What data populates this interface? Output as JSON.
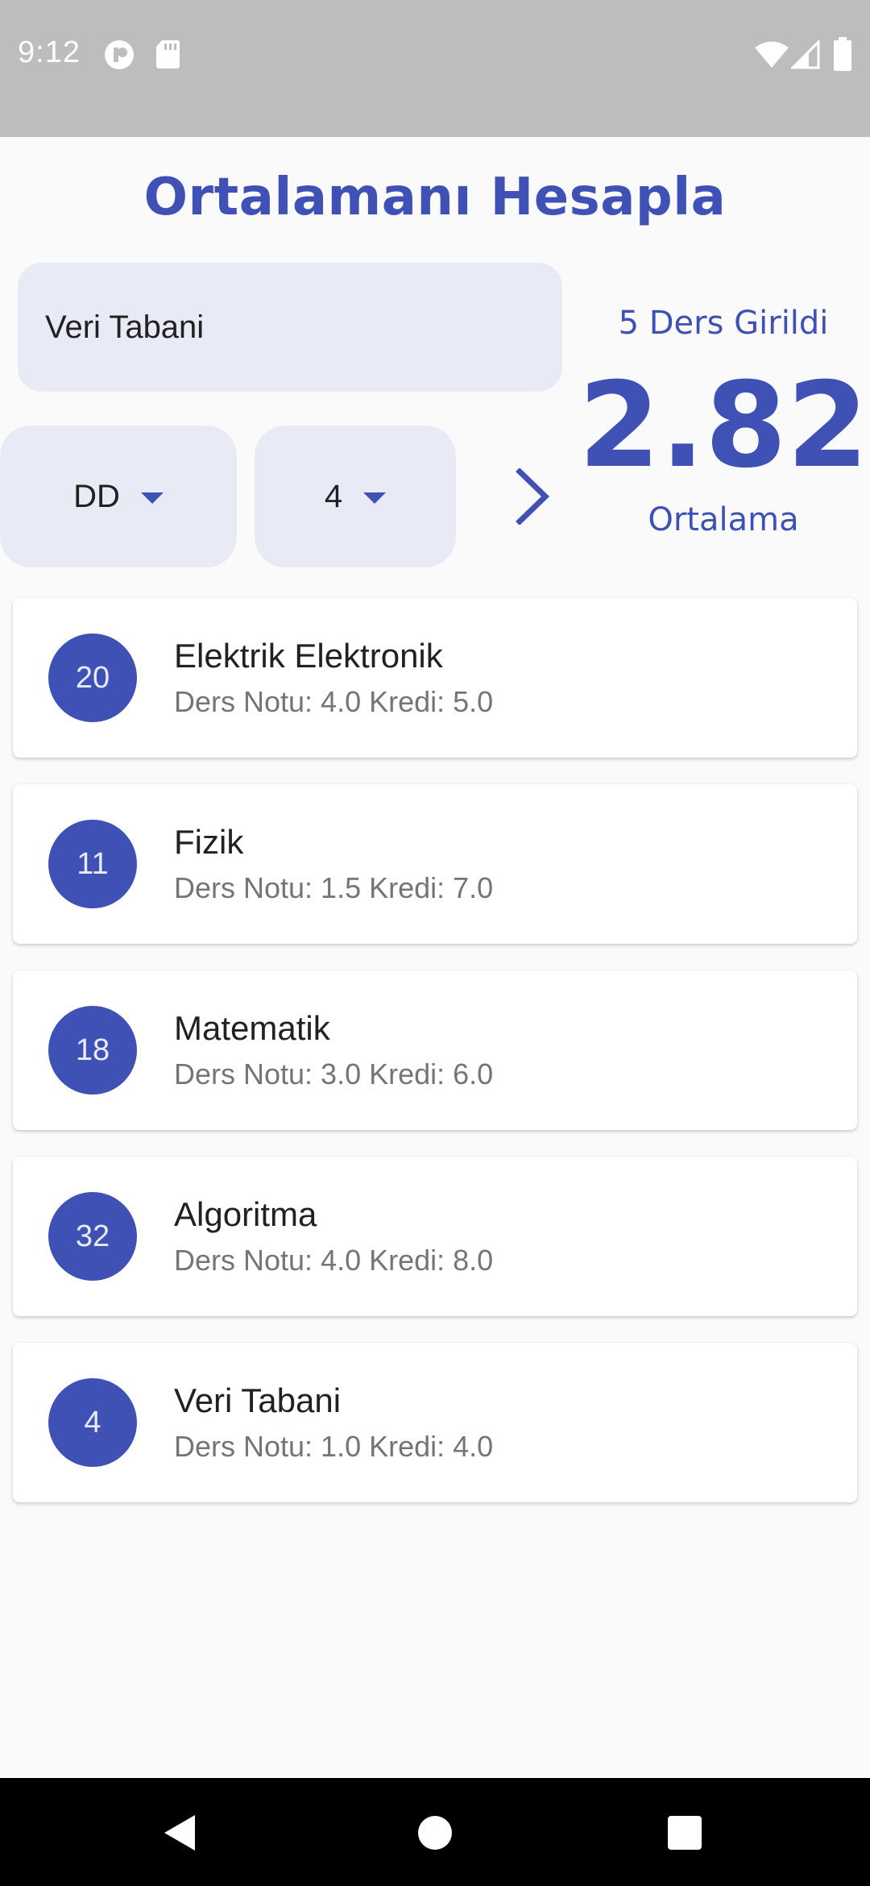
{
  "status_bar": {
    "time": "9:12",
    "icons": [
      "privacy-dot-icon",
      "sd-card-icon",
      "wifi-icon",
      "signal-icon",
      "battery-icon"
    ]
  },
  "app": {
    "title": "Ortalamanı Hesapla",
    "accent_color": "#3f51b5",
    "field_color": "#e8eaf6"
  },
  "form": {
    "course_name_value": "Veri Tabani",
    "grade_selected": "DD",
    "credit_selected": "4",
    "add_icon": "chevron-right-icon"
  },
  "summary": {
    "count_text": "5 Ders Girildi",
    "average": "2.82",
    "label": "Ortalama"
  },
  "courses": [
    {
      "badge": "20",
      "name": "Elektrik Elektronik",
      "detail": "Ders Notu: 4.0 Kredi: 5.0"
    },
    {
      "badge": "11",
      "name": "Fizik",
      "detail": "Ders Notu: 1.5 Kredi: 7.0"
    },
    {
      "badge": "18",
      "name": "Matematik",
      "detail": "Ders Notu: 3.0 Kredi: 6.0"
    },
    {
      "badge": "32",
      "name": "Algoritma",
      "detail": "Ders Notu: 4.0 Kredi: 8.0"
    },
    {
      "badge": "4",
      "name": "Veri Tabani",
      "detail": "Ders Notu: 1.0 Kredi: 4.0"
    }
  ],
  "nav_bar": {
    "buttons": [
      "back-icon",
      "home-icon",
      "recents-icon"
    ]
  }
}
